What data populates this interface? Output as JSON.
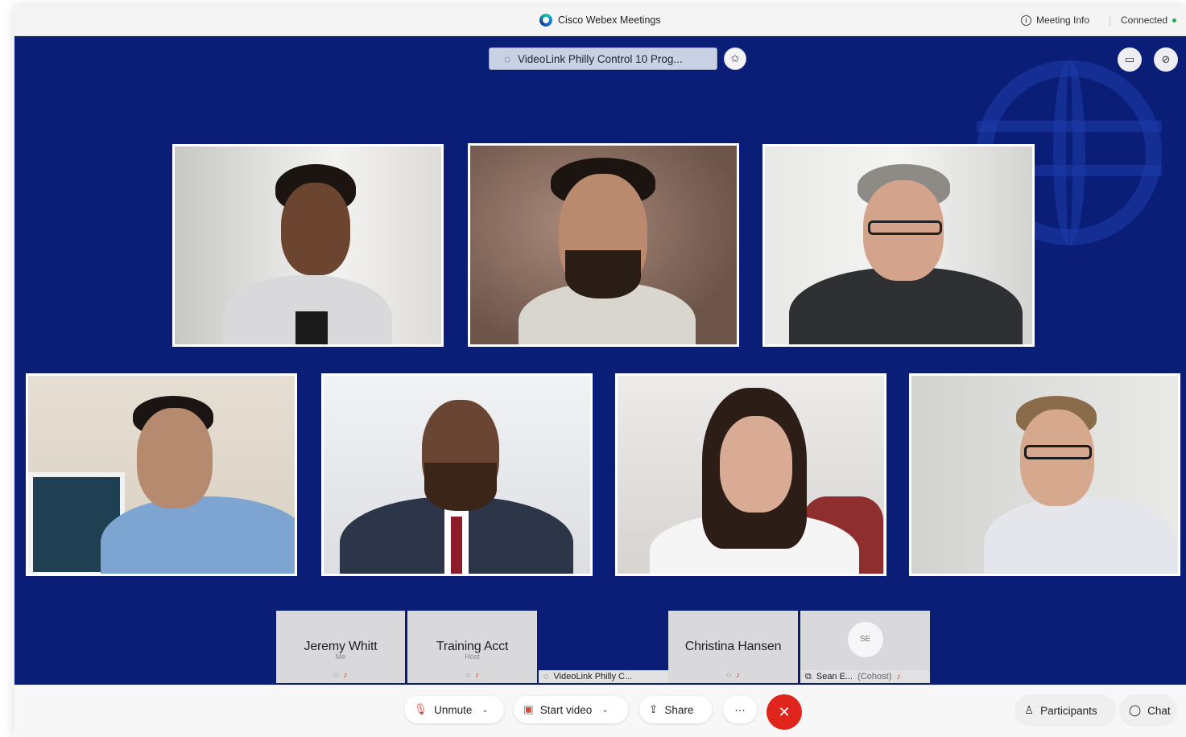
{
  "window": {
    "app_title": "Cisco Webex Meetings",
    "meeting_info_label": "Meeting Info",
    "connection_status": "Connected"
  },
  "stage": {
    "device_pill": "VideoLink Philly Control 10 Prog...",
    "icons": {
      "device": "proximity-icon",
      "pin": "pin-icon",
      "layout": "layout-icon",
      "popout": "popout-icon"
    }
  },
  "thumbnails": [
    {
      "name": "Jeremy Whitt",
      "role": "Me"
    },
    {
      "name": "Training Acct",
      "role": "Host"
    },
    {
      "name": "Christina Hansen",
      "role": ""
    },
    {
      "name": "SE",
      "role": ""
    }
  ],
  "strip_items": [
    {
      "label": "VideoLink Philly C..."
    },
    {
      "label": "Sean E...",
      "role": "(Cohost)"
    }
  ],
  "controls": {
    "unmute": "Unmute",
    "start_video": "Start video",
    "share": "Share",
    "more": "···",
    "end": "✕",
    "participants": "Participants",
    "chat": "Chat"
  },
  "colors": {
    "stage_bg": "#0a1e78",
    "end_button": "#e0261c",
    "muted_icon": "#d84a3a"
  }
}
